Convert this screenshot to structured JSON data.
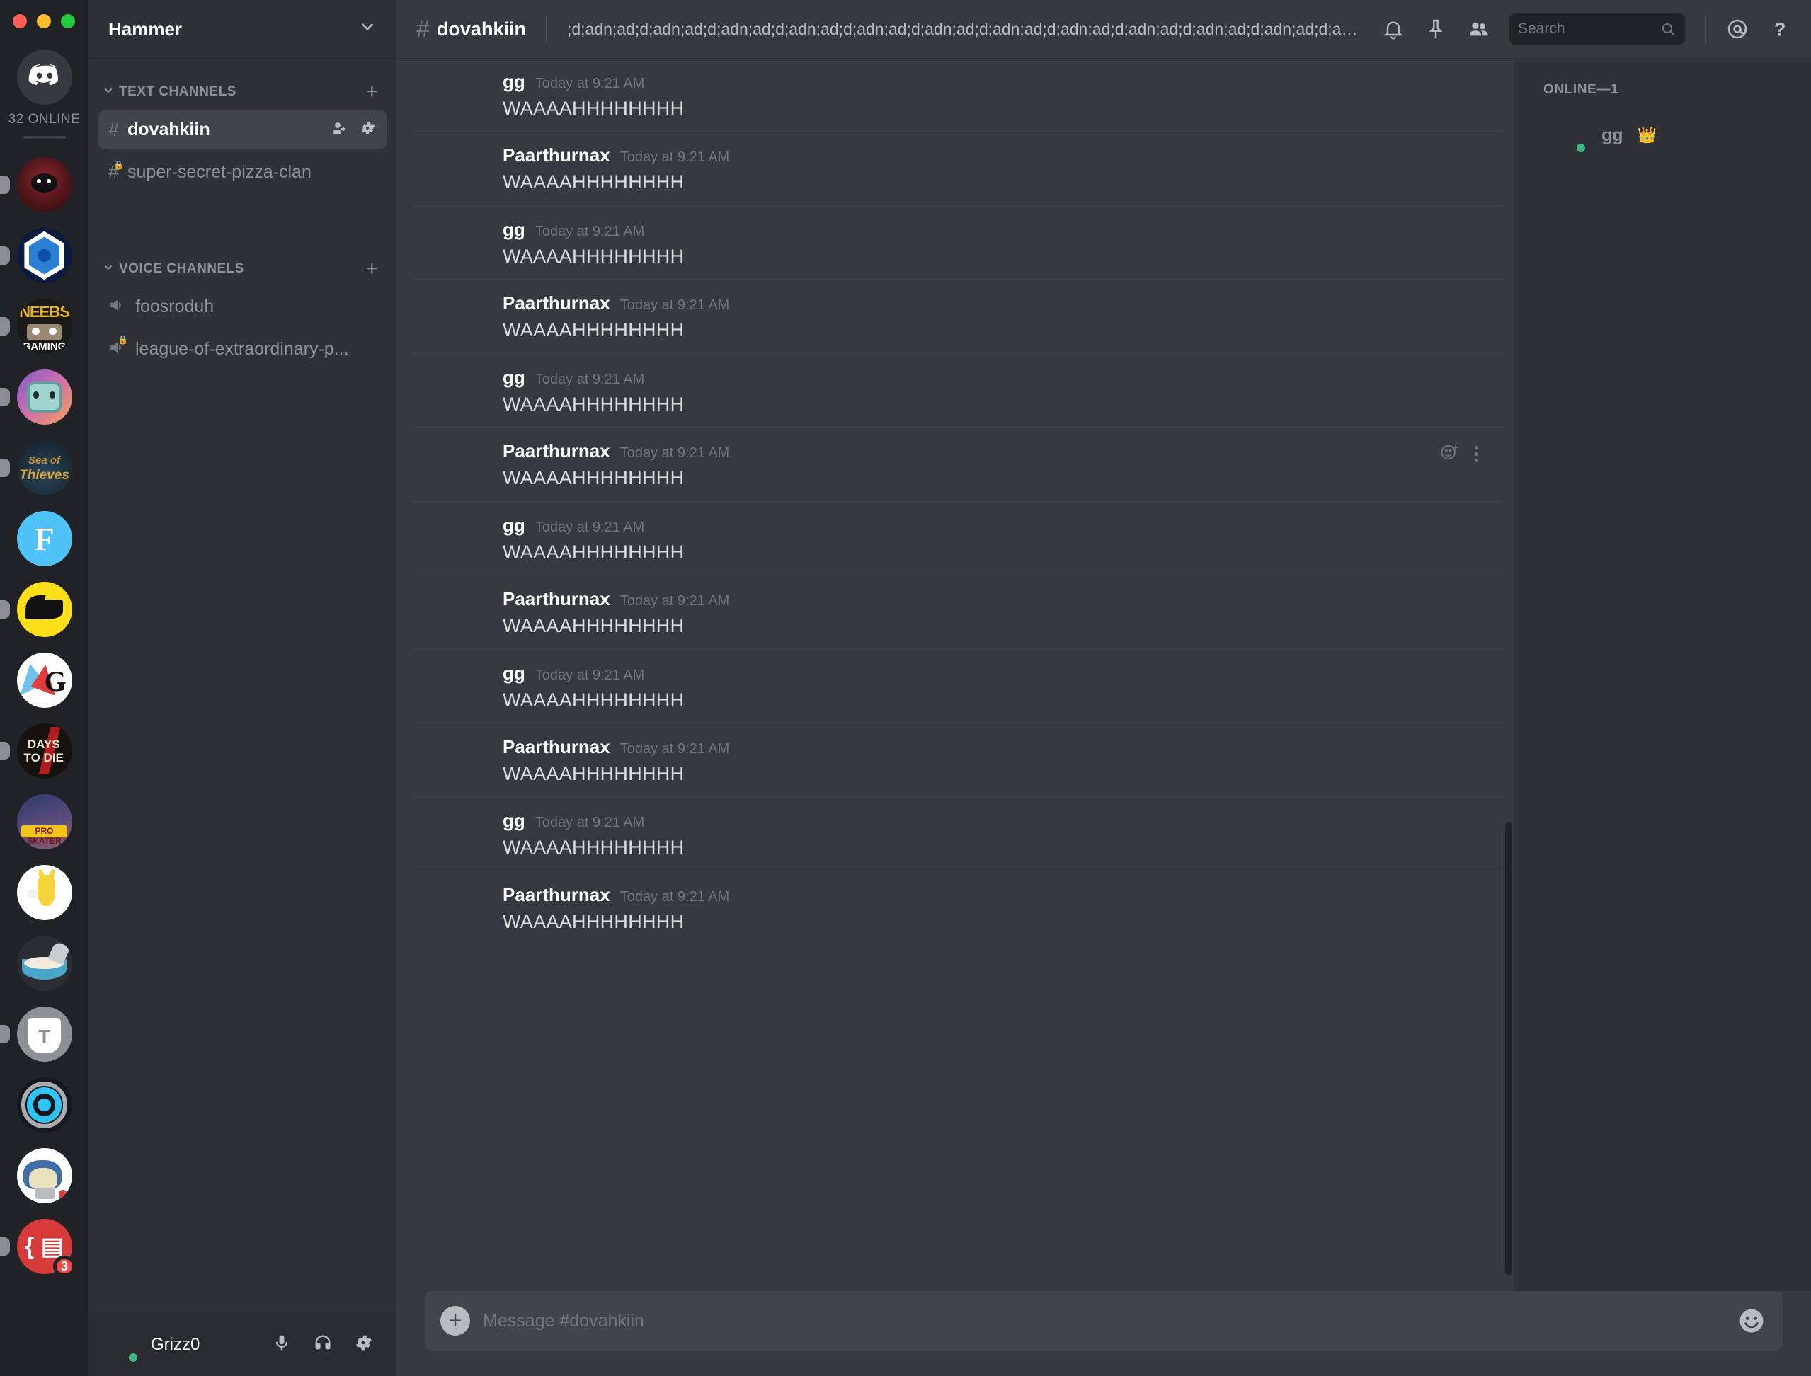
{
  "window": {
    "traffic_lights": [
      "close",
      "minimize",
      "maximize"
    ]
  },
  "rail": {
    "home_label": "discord-home",
    "online_count": "32 ONLINE",
    "servers": [
      {
        "name": "red-hooded-figure",
        "badge": null,
        "active_pill": true
      },
      {
        "name": "blue-hex-logo",
        "badge": null,
        "active_pill": true
      },
      {
        "name": "neebs-gaming",
        "badge": null,
        "active_pill": true
      },
      {
        "name": "robot-tv-head",
        "badge": null,
        "active_pill": true
      },
      {
        "name": "sea-of-thieves",
        "badge": null,
        "active_pill": true
      },
      {
        "name": "f-logo-blue",
        "badge": null,
        "active_pill": false
      },
      {
        "name": "corsair-yellow",
        "badge": null,
        "active_pill": true
      },
      {
        "name": "g-logo-white",
        "badge": null,
        "active_pill": false
      },
      {
        "name": "7-days-to-die",
        "badge": null,
        "active_pill": true
      },
      {
        "name": "tony-hawk-pro-skater",
        "badge": null,
        "active_pill": false
      },
      {
        "name": "pikachu-white",
        "badge": null,
        "active_pill": false
      },
      {
        "name": "cereal-bowl",
        "badge": null,
        "active_pill": false
      },
      {
        "name": "t-logo-grey",
        "badge": null,
        "active_pill": true
      },
      {
        "name": "blue-target-ring",
        "badge": null,
        "active_pill": false
      },
      {
        "name": "snorlax-laptop",
        "badge": null,
        "active_pill": false
      },
      {
        "name": "red-script-logo",
        "badge": "3",
        "active_pill": true
      }
    ]
  },
  "sidebar": {
    "guild_name": "Hammer",
    "categories": [
      {
        "label": "TEXT CHANNELS",
        "type": "text",
        "channels": [
          {
            "name": "dovahkiin",
            "active": true,
            "locked": false
          },
          {
            "name": "super-secret-pizza-clan",
            "active": false,
            "locked": true
          }
        ]
      },
      {
        "label": "VOICE CHANNELS",
        "type": "voice",
        "channels": [
          {
            "name": "foosroduh",
            "active": false,
            "locked": false
          },
          {
            "name": "league-of-extraordinary-p...",
            "active": false,
            "locked": true
          }
        ]
      }
    ],
    "user": {
      "name": "Grizz0",
      "status": "online"
    }
  },
  "header": {
    "channel_name": "dovahkiin",
    "topic": ";d;adn;ad;d;adn;ad;d;adn;ad;d;adn;ad;d;adn;ad;d;adn;ad;d;adn;ad;d;adn;ad;d;adn;ad;d;adn;ad;d;adn;ad;d;adn;a...",
    "search_placeholder": "Search"
  },
  "messages": [
    {
      "author": "gg",
      "timestamp": "Today at 9:21 AM",
      "content": "WAAAAHHHHHHHH",
      "avatar": "gg",
      "first": true,
      "hover": false
    },
    {
      "author": "Paarthurnax",
      "timestamp": "Today at 9:21 AM",
      "content": "WAAAAHHHHHHHH",
      "avatar": "paarthurnax",
      "first": false,
      "hover": false
    },
    {
      "author": "gg",
      "timestamp": "Today at 9:21 AM",
      "content": "WAAAAHHHHHHHH",
      "avatar": "gg",
      "first": false,
      "hover": false
    },
    {
      "author": "Paarthurnax",
      "timestamp": "Today at 9:21 AM",
      "content": "WAAAAHHHHHHHH",
      "avatar": "paarthurnax",
      "first": false,
      "hover": false
    },
    {
      "author": "gg",
      "timestamp": "Today at 9:21 AM",
      "content": "WAAAAHHHHHHHH",
      "avatar": "gg",
      "first": false,
      "hover": false
    },
    {
      "author": "Paarthurnax",
      "timestamp": "Today at 9:21 AM",
      "content": "WAAAAHHHHHHHH",
      "avatar": "paarthurnax",
      "first": false,
      "hover": true
    },
    {
      "author": "gg",
      "timestamp": "Today at 9:21 AM",
      "content": "WAAAAHHHHHHHH",
      "avatar": "gg",
      "first": false,
      "hover": false
    },
    {
      "author": "Paarthurnax",
      "timestamp": "Today at 9:21 AM",
      "content": "WAAAAHHHHHHHH",
      "avatar": "paarthurnax",
      "first": false,
      "hover": false
    },
    {
      "author": "gg",
      "timestamp": "Today at 9:21 AM",
      "content": "WAAAAHHHHHHHH",
      "avatar": "gg",
      "first": false,
      "hover": false
    },
    {
      "author": "Paarthurnax",
      "timestamp": "Today at 9:21 AM",
      "content": "WAAAAHHHHHHHH",
      "avatar": "paarthurnax",
      "first": false,
      "hover": false
    },
    {
      "author": "gg",
      "timestamp": "Today at 9:21 AM",
      "content": "WAAAAHHHHHHHH",
      "avatar": "gg",
      "first": false,
      "hover": false
    },
    {
      "author": "Paarthurnax",
      "timestamp": "Today at 9:21 AM",
      "content": "WAAAAHHHHHHHH",
      "avatar": "paarthurnax",
      "first": false,
      "hover": false
    }
  ],
  "composer": {
    "placeholder": "Message #dovahkiin"
  },
  "members": {
    "group_label": "ONLINE—1",
    "list": [
      {
        "name": "gg",
        "owner": true,
        "status": "online"
      }
    ]
  },
  "colors": {
    "rail_bg": "#202225",
    "sidebar_bg": "#2f3136",
    "main_bg": "#36393f",
    "accent_online": "#43b581",
    "badge_red": "#f04747",
    "crown_gold": "#faa61a"
  }
}
